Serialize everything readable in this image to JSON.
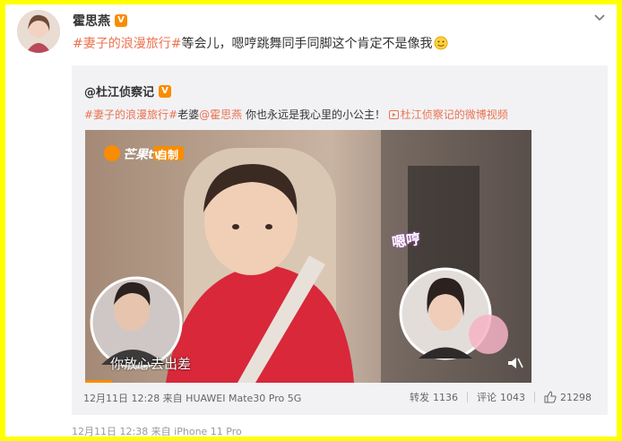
{
  "post": {
    "author": "霍思燕",
    "verified_badge": "V",
    "tag": "#妻子的浪漫旅行#",
    "text": "等会儿，嗯哼跳舞同手同脚这个肯定不是像我"
  },
  "repost": {
    "author": "@杜江侦察记",
    "verified_badge": "V",
    "tag": "#妻子的浪漫旅行#",
    "text_a": "老婆",
    "mention": "@霍思燕",
    "text_b": " 你也永远是我心里的小公主！ ",
    "link_label": "杜江侦察记的微博视频",
    "video": {
      "channel_logo": "芒果tv",
      "channel_tag": "自制",
      "subtitle": "你放心去出差",
      "overlay_text": "嗯哼",
      "progress_fraction": 0.06
    },
    "meta": "12月11日 12:28 来自 HUAWEI Mate30 Pro 5G",
    "repost_label": "转发",
    "repost_count": "1136",
    "comment_label": "评论",
    "comment_count": "1043",
    "like_count": "21298"
  },
  "footer_meta": "12月11日 12:38  来自 iPhone 11 Pro",
  "colors": {
    "border": "#ffff00",
    "link": "#eb7350",
    "badge": "#f98c00",
    "repost_bg": "#f2f2f5"
  }
}
